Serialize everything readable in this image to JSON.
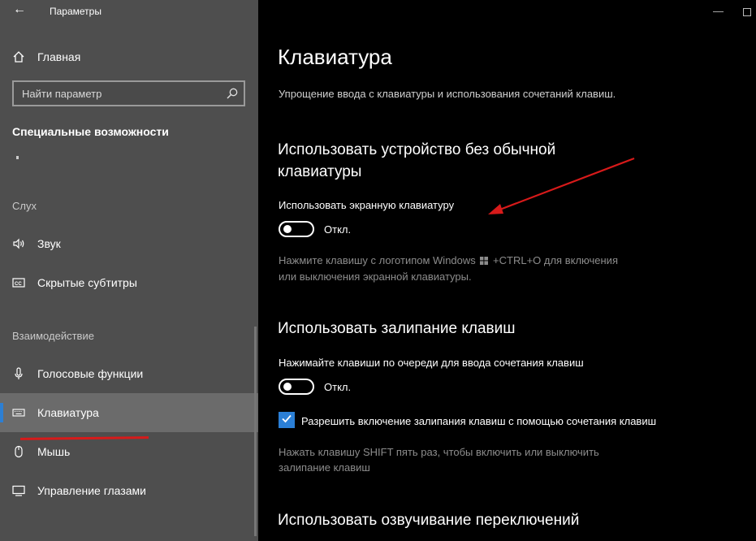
{
  "window": {
    "title": "Параметры",
    "minimize_glyph": "—"
  },
  "sidebar": {
    "back_glyph": "←",
    "home_label": "Главная",
    "search_placeholder": "Найти параметр",
    "section_title": "Специальные возможности",
    "groups": {
      "hearing": "Слух",
      "interaction": "Взаимодействие"
    },
    "items": [
      {
        "label": "Звук",
        "icon": "speaker-icon"
      },
      {
        "label": "Скрытые субтитры",
        "icon": "closed-captions-icon"
      },
      {
        "label": "Голосовые функции",
        "icon": "microphone-icon"
      },
      {
        "label": "Клавиатура",
        "icon": "keyboard-icon",
        "selected": true
      },
      {
        "label": "Мышь",
        "icon": "mouse-icon"
      },
      {
        "label": "Управление глазами",
        "icon": "eye-control-icon"
      }
    ]
  },
  "content": {
    "title": "Клавиатура",
    "description": "Упрощение ввода с клавиатуры и использования сочетаний клавиш.",
    "onscreen": {
      "heading_line1": "Использовать устройство без обычной",
      "heading_line2": "клавиатуры",
      "label": "Использовать экранную клавиатуру",
      "state": "Откл.",
      "hint_part1": "Нажмите клавишу с логотипом Windows",
      "hint_part2": "+CTRL+O для включения",
      "hint_line2": "или выключения экранной клавиатуры."
    },
    "sticky": {
      "heading": "Использовать залипание клавиш",
      "label": "Нажимайте клавиши по очереди для ввода сочетания клавиш",
      "state": "Откл.",
      "checkbox_label": "Разрешить включение залипания клавиш с помощью сочетания клавиш",
      "hint_line1": "Нажать клавишу SHIFT пять раз, чтобы включить или выключить",
      "hint_line2": "залипание клавиш"
    },
    "toggle_keys": {
      "heading": "Использовать озвучивание переключений"
    }
  },
  "colors": {
    "sidebar_bg": "#4e4e4e",
    "selected_bg": "#6b6b6b",
    "accent": "#2b7fd6",
    "annotation_red": "#d71a1a"
  }
}
